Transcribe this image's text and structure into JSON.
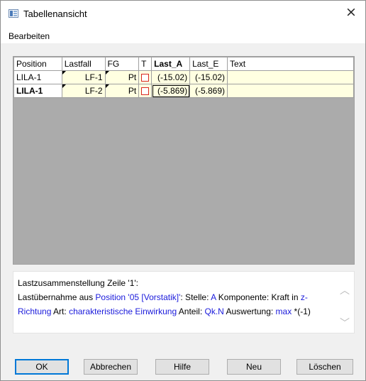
{
  "window": {
    "title": "Tabellenansicht",
    "close_glyph": "×"
  },
  "menu": {
    "items": [
      "Bearbeiten"
    ]
  },
  "grid": {
    "columns": [
      "Position",
      "Lastfall",
      "FG",
      "T",
      "Last_A",
      "Last_E",
      "Text"
    ],
    "rows": [
      {
        "position": "LILA-1",
        "lastfall": "LF-1",
        "fg": "Pt",
        "last_a": "(-15.02)",
        "last_e": "(-15.02)",
        "text": ""
      },
      {
        "position": "LILA-1",
        "lastfall": "LF-2",
        "fg": "Pt",
        "last_a": "(-5.869)",
        "last_e": "(-5.869)",
        "text": ""
      }
    ]
  },
  "description": {
    "line1": "Lastzusammenstellung Zeile '1':",
    "p1": "Lastübernahme aus ",
    "v1": "Position '05 [Vorstatik]'",
    "p2": ": Stelle: ",
    "v2": "A",
    "p3": " Komponente: Kraft in ",
    "v3": "z-Richtung",
    "p4": " Art: ",
    "v4": "charakteristische Einwirkung",
    "p5": " Anteil: ",
    "v5": "Qk.N",
    "p6": " Auswertung: ",
    "v6": "max",
    "p7": " *(-1)",
    "scroll_up": "︿",
    "scroll_down": "﹀"
  },
  "buttons": {
    "ok": "OK",
    "cancel": "Abbrechen",
    "help": "Hilfe",
    "new": "Neu",
    "delete": "Löschen"
  },
  "colors": {
    "value_link": "#1a1adb",
    "row_bg": "#ffffe1",
    "grid_empty": "#ababab",
    "checkbox_border": "#d9271e"
  }
}
